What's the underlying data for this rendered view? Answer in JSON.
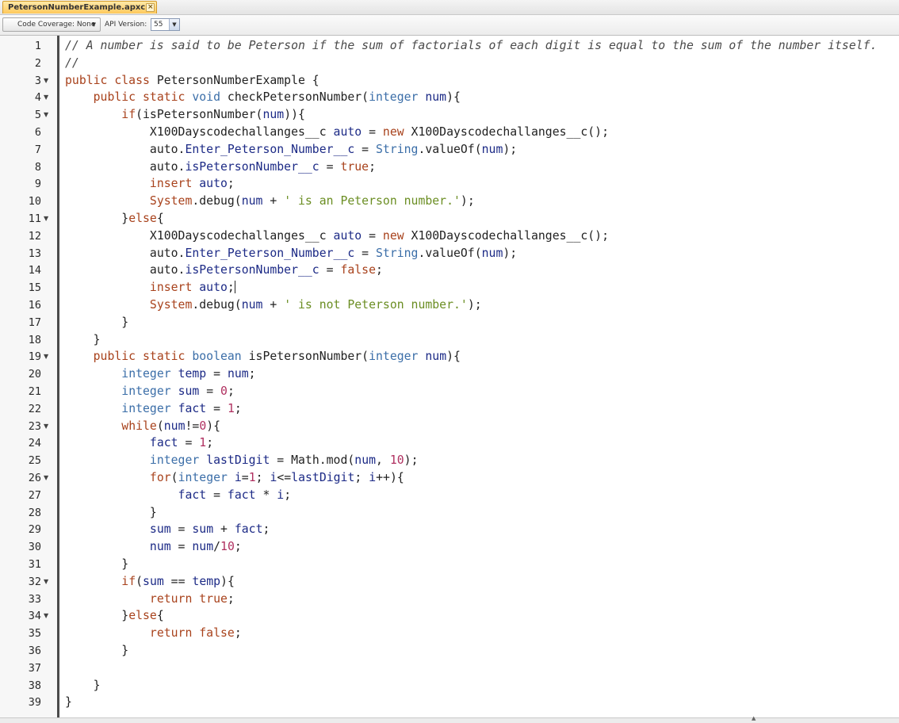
{
  "tab": {
    "label": "PetersonNumberExample.apxc",
    "close_glyph": "×"
  },
  "toolbar": {
    "coverage_label": "Code Coverage: None",
    "api_label": "API Version:",
    "api_value": "55"
  },
  "code_lines": [
    {
      "n": "1",
      "fold": false,
      "indent": 0,
      "tokens": [
        [
          "cm",
          "// A number is said to be Peterson if the sum of factorials of each digit is equal to the sum of the number itself."
        ]
      ]
    },
    {
      "n": "2",
      "fold": false,
      "indent": 0,
      "tokens": [
        [
          "cm",
          "//"
        ]
      ]
    },
    {
      "n": "3",
      "fold": true,
      "indent": 0,
      "tokens": [
        [
          "kw",
          "public class "
        ],
        [
          "df",
          "PetersonNumberExample {"
        ]
      ]
    },
    {
      "n": "4",
      "fold": true,
      "indent": 1,
      "tokens": [
        [
          "kw",
          "public static "
        ],
        [
          "ty",
          "void "
        ],
        [
          "df",
          "checkPetersonNumber("
        ],
        [
          "ty",
          "integer "
        ],
        [
          "vr",
          "num"
        ],
        [
          "df",
          "){"
        ]
      ]
    },
    {
      "n": "5",
      "fold": true,
      "indent": 2,
      "tokens": [
        [
          "kw",
          "if"
        ],
        [
          "df",
          "(isPetersonNumber("
        ],
        [
          "vr",
          "num"
        ],
        [
          "df",
          ")){"
        ]
      ]
    },
    {
      "n": "6",
      "fold": false,
      "indent": 3,
      "tokens": [
        [
          "df",
          "X100Dayscodechallanges__c "
        ],
        [
          "vr",
          "auto"
        ],
        [
          "df",
          " = "
        ],
        [
          "kw",
          "new "
        ],
        [
          "df",
          "X100Dayscodechallanges__c();"
        ]
      ]
    },
    {
      "n": "7",
      "fold": false,
      "indent": 3,
      "tokens": [
        [
          "df",
          "auto."
        ],
        [
          "vr",
          "Enter_Peterson_Number__c"
        ],
        [
          "df",
          " = "
        ],
        [
          "ty",
          "String"
        ],
        [
          "df",
          ".valueOf("
        ],
        [
          "vr",
          "num"
        ],
        [
          "df",
          ");"
        ]
      ]
    },
    {
      "n": "8",
      "fold": false,
      "indent": 3,
      "tokens": [
        [
          "df",
          "auto."
        ],
        [
          "vr",
          "isPetersonNumber__c"
        ],
        [
          "df",
          " = "
        ],
        [
          "kw",
          "true"
        ],
        [
          "df",
          ";"
        ]
      ]
    },
    {
      "n": "9",
      "fold": false,
      "indent": 3,
      "tokens": [
        [
          "kw",
          "insert "
        ],
        [
          "vr",
          "auto"
        ],
        [
          "df",
          ";"
        ]
      ]
    },
    {
      "n": "10",
      "fold": false,
      "indent": 3,
      "tokens": [
        [
          "kw",
          "System"
        ],
        [
          "df",
          ".debug("
        ],
        [
          "vr",
          "num"
        ],
        [
          "df",
          " + "
        ],
        [
          "st",
          "' is an Peterson number.'"
        ],
        [
          "df",
          ");"
        ]
      ]
    },
    {
      "n": "11",
      "fold": true,
      "indent": 2,
      "tokens": [
        [
          "df",
          "}"
        ],
        [
          "kw",
          "else"
        ],
        [
          "df",
          "{"
        ]
      ]
    },
    {
      "n": "12",
      "fold": false,
      "indent": 3,
      "tokens": [
        [
          "df",
          "X100Dayscodechallanges__c "
        ],
        [
          "vr",
          "auto"
        ],
        [
          "df",
          " = "
        ],
        [
          "kw",
          "new "
        ],
        [
          "df",
          "X100Dayscodechallanges__c();"
        ]
      ]
    },
    {
      "n": "13",
      "fold": false,
      "indent": 3,
      "tokens": [
        [
          "df",
          "auto."
        ],
        [
          "vr",
          "Enter_Peterson_Number__c"
        ],
        [
          "df",
          " = "
        ],
        [
          "ty",
          "String"
        ],
        [
          "df",
          ".valueOf("
        ],
        [
          "vr",
          "num"
        ],
        [
          "df",
          ");"
        ]
      ]
    },
    {
      "n": "14",
      "fold": false,
      "indent": 3,
      "tokens": [
        [
          "df",
          "auto."
        ],
        [
          "vr",
          "isPetersonNumber__c"
        ],
        [
          "df",
          " = "
        ],
        [
          "kw",
          "false"
        ],
        [
          "df",
          ";"
        ]
      ]
    },
    {
      "n": "15",
      "fold": false,
      "indent": 3,
      "caret": true,
      "tokens": [
        [
          "kw",
          "insert "
        ],
        [
          "vr",
          "auto"
        ],
        [
          "df",
          ";"
        ]
      ]
    },
    {
      "n": "16",
      "fold": false,
      "indent": 3,
      "tokens": [
        [
          "kw",
          "System"
        ],
        [
          "df",
          ".debug("
        ],
        [
          "vr",
          "num"
        ],
        [
          "df",
          " + "
        ],
        [
          "st",
          "' is not Peterson number.'"
        ],
        [
          "df",
          ");"
        ]
      ]
    },
    {
      "n": "17",
      "fold": false,
      "indent": 2,
      "tokens": [
        [
          "df",
          "}"
        ]
      ]
    },
    {
      "n": "18",
      "fold": false,
      "indent": 1,
      "tokens": [
        [
          "df",
          "}"
        ]
      ]
    },
    {
      "n": "19",
      "fold": true,
      "indent": 1,
      "tokens": [
        [
          "kw",
          "public static "
        ],
        [
          "ty",
          "boolean "
        ],
        [
          "df",
          "isPetersonNumber("
        ],
        [
          "ty",
          "integer "
        ],
        [
          "vr",
          "num"
        ],
        [
          "df",
          "){"
        ]
      ]
    },
    {
      "n": "20",
      "fold": false,
      "indent": 2,
      "tokens": [
        [
          "ty",
          "integer "
        ],
        [
          "vr",
          "temp"
        ],
        [
          "df",
          " = "
        ],
        [
          "vr",
          "num"
        ],
        [
          "df",
          ";"
        ]
      ]
    },
    {
      "n": "21",
      "fold": false,
      "indent": 2,
      "tokens": [
        [
          "ty",
          "integer "
        ],
        [
          "vr",
          "sum"
        ],
        [
          "df",
          " = "
        ],
        [
          "nm",
          "0"
        ],
        [
          "df",
          ";"
        ]
      ]
    },
    {
      "n": "22",
      "fold": false,
      "indent": 2,
      "tokens": [
        [
          "ty",
          "integer "
        ],
        [
          "vr",
          "fact"
        ],
        [
          "df",
          " = "
        ],
        [
          "nm",
          "1"
        ],
        [
          "df",
          ";"
        ]
      ]
    },
    {
      "n": "23",
      "fold": true,
      "indent": 2,
      "tokens": [
        [
          "kw",
          "while"
        ],
        [
          "df",
          "("
        ],
        [
          "vr",
          "num"
        ],
        [
          "df",
          "!="
        ],
        [
          "nm",
          "0"
        ],
        [
          "df",
          "){"
        ]
      ]
    },
    {
      "n": "24",
      "fold": false,
      "indent": 3,
      "tokens": [
        [
          "vr",
          "fact"
        ],
        [
          "df",
          " = "
        ],
        [
          "nm",
          "1"
        ],
        [
          "df",
          ";"
        ]
      ]
    },
    {
      "n": "25",
      "fold": false,
      "indent": 3,
      "tokens": [
        [
          "ty",
          "integer "
        ],
        [
          "vr",
          "lastDigit"
        ],
        [
          "df",
          " = Math.mod("
        ],
        [
          "vr",
          "num"
        ],
        [
          "df",
          ", "
        ],
        [
          "nm",
          "10"
        ],
        [
          "df",
          ");"
        ]
      ]
    },
    {
      "n": "26",
      "fold": true,
      "indent": 3,
      "tokens": [
        [
          "kw",
          "for"
        ],
        [
          "df",
          "("
        ],
        [
          "ty",
          "integer "
        ],
        [
          "vr",
          "i"
        ],
        [
          "df",
          "="
        ],
        [
          "nm",
          "1"
        ],
        [
          "df",
          "; "
        ],
        [
          "vr",
          "i"
        ],
        [
          "df",
          "<="
        ],
        [
          "vr",
          "lastDigit"
        ],
        [
          "df",
          "; "
        ],
        [
          "vr",
          "i"
        ],
        [
          "df",
          "++){"
        ]
      ]
    },
    {
      "n": "27",
      "fold": false,
      "indent": 4,
      "tokens": [
        [
          "vr",
          "fact"
        ],
        [
          "df",
          " = "
        ],
        [
          "vr",
          "fact"
        ],
        [
          "df",
          " * "
        ],
        [
          "vr",
          "i"
        ],
        [
          "df",
          ";"
        ]
      ]
    },
    {
      "n": "28",
      "fold": false,
      "indent": 3,
      "tokens": [
        [
          "df",
          "}"
        ]
      ]
    },
    {
      "n": "29",
      "fold": false,
      "indent": 3,
      "tokens": [
        [
          "vr",
          "sum"
        ],
        [
          "df",
          " = "
        ],
        [
          "vr",
          "sum"
        ],
        [
          "df",
          " + "
        ],
        [
          "vr",
          "fact"
        ],
        [
          "df",
          ";"
        ]
      ]
    },
    {
      "n": "30",
      "fold": false,
      "indent": 3,
      "tokens": [
        [
          "vr",
          "num"
        ],
        [
          "df",
          " = "
        ],
        [
          "vr",
          "num"
        ],
        [
          "df",
          "/"
        ],
        [
          "nm",
          "10"
        ],
        [
          "df",
          ";"
        ]
      ]
    },
    {
      "n": "31",
      "fold": false,
      "indent": 2,
      "tokens": [
        [
          "df",
          "}"
        ]
      ]
    },
    {
      "n": "32",
      "fold": true,
      "indent": 2,
      "tokens": [
        [
          "kw",
          "if"
        ],
        [
          "df",
          "("
        ],
        [
          "vr",
          "sum"
        ],
        [
          "df",
          " == "
        ],
        [
          "vr",
          "temp"
        ],
        [
          "df",
          "){"
        ]
      ]
    },
    {
      "n": "33",
      "fold": false,
      "indent": 3,
      "tokens": [
        [
          "kw",
          "return "
        ],
        [
          "kw",
          "true"
        ],
        [
          "df",
          ";"
        ]
      ]
    },
    {
      "n": "34",
      "fold": true,
      "indent": 2,
      "tokens": [
        [
          "df",
          "}"
        ],
        [
          "kw",
          "else"
        ],
        [
          "df",
          "{"
        ]
      ]
    },
    {
      "n": "35",
      "fold": false,
      "indent": 3,
      "tokens": [
        [
          "kw",
          "return "
        ],
        [
          "kw",
          "false"
        ],
        [
          "df",
          ";"
        ]
      ]
    },
    {
      "n": "36",
      "fold": false,
      "indent": 2,
      "tokens": [
        [
          "df",
          "}"
        ]
      ]
    },
    {
      "n": "37",
      "fold": false,
      "indent": 0,
      "tokens": []
    },
    {
      "n": "38",
      "fold": false,
      "indent": 1,
      "tokens": [
        [
          "df",
          "}"
        ]
      ]
    },
    {
      "n": "39",
      "fold": false,
      "indent": 0,
      "tokens": [
        [
          "df",
          "}"
        ]
      ]
    }
  ]
}
